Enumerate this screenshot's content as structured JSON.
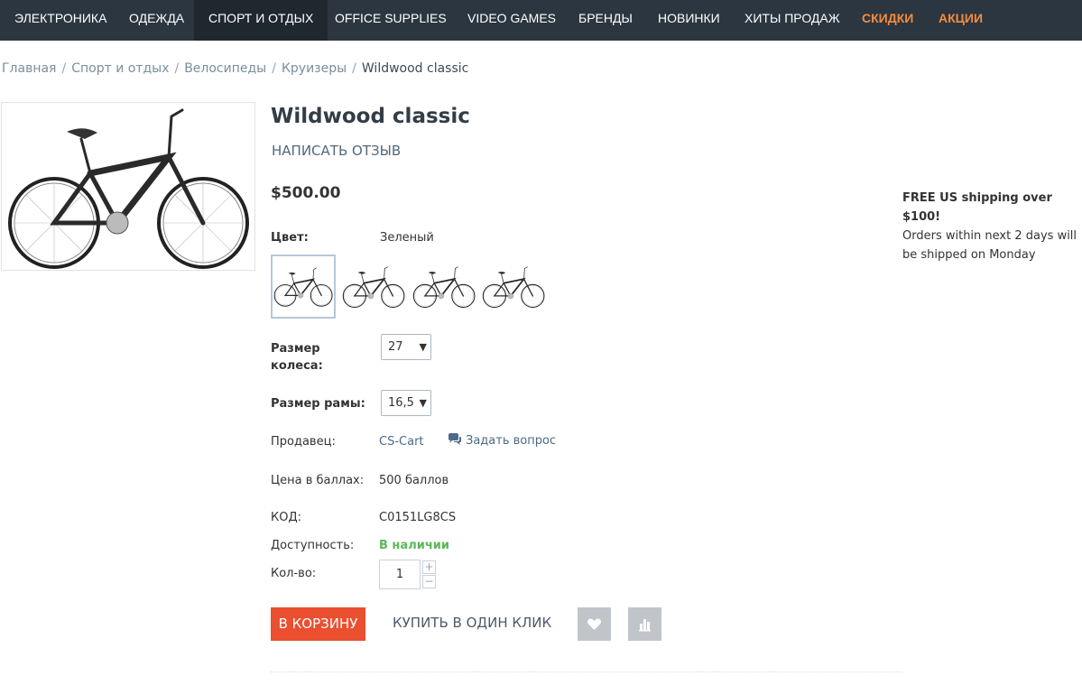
{
  "nav": {
    "items": [
      {
        "label": "ЭЛЕКТРОНИКА"
      },
      {
        "label": "ОДЕЖДА"
      },
      {
        "label": "СПОРТ И ОТДЫХ"
      },
      {
        "label": "OFFICE SUPPLIES"
      },
      {
        "label": "VIDEO GAMES"
      },
      {
        "label": "БРЕНДЫ"
      },
      {
        "label": "НОВИНКИ"
      },
      {
        "label": "ХИТЫ ПРОДАЖ"
      },
      {
        "label": "СКИДКИ"
      },
      {
        "label": "АКЦИИ"
      }
    ],
    "active": "СПОРТ И ОТДЫХ",
    "highlight_color": "#f58b3c"
  },
  "breadcrumb": [
    "Главная",
    "Спорт и отдых",
    "Велосипеды",
    "Круизеры",
    "Wildwood classic"
  ],
  "product": {
    "title": "Wildwood classic",
    "write_review": "НАПИСАТЬ ОТЗЫВ",
    "price": "$500.00",
    "color_label": "Цвет:",
    "color_value": "Зеленый",
    "wheel_label": "Размер колеса:",
    "wheel_value": "27",
    "frame_label": "Размер рамы:",
    "frame_value": "16,5",
    "seller_label": "Продавец:",
    "seller_value": "CS-Cart",
    "ask_question": "Задать вопрос",
    "points_label": "Цена в баллах:",
    "points_value": "500 баллов",
    "code_label": "КОД:",
    "code_value": "C0151LG8CS",
    "availability_label": "Доступность:",
    "availability_value": "В наличии",
    "availability_color": "#5cb85c",
    "qty_label": "Кол-во:",
    "qty_value": "1",
    "add_to_cart": "В КОРЗИНУ",
    "buy_one_click": "КУПИТЬ В ОДИН КЛИК",
    "cart_color": "#ea4f30"
  },
  "shipping": {
    "headline": "FREE US shipping over $100!",
    "note": "Orders within next 2 days will be shipped on Monday"
  }
}
